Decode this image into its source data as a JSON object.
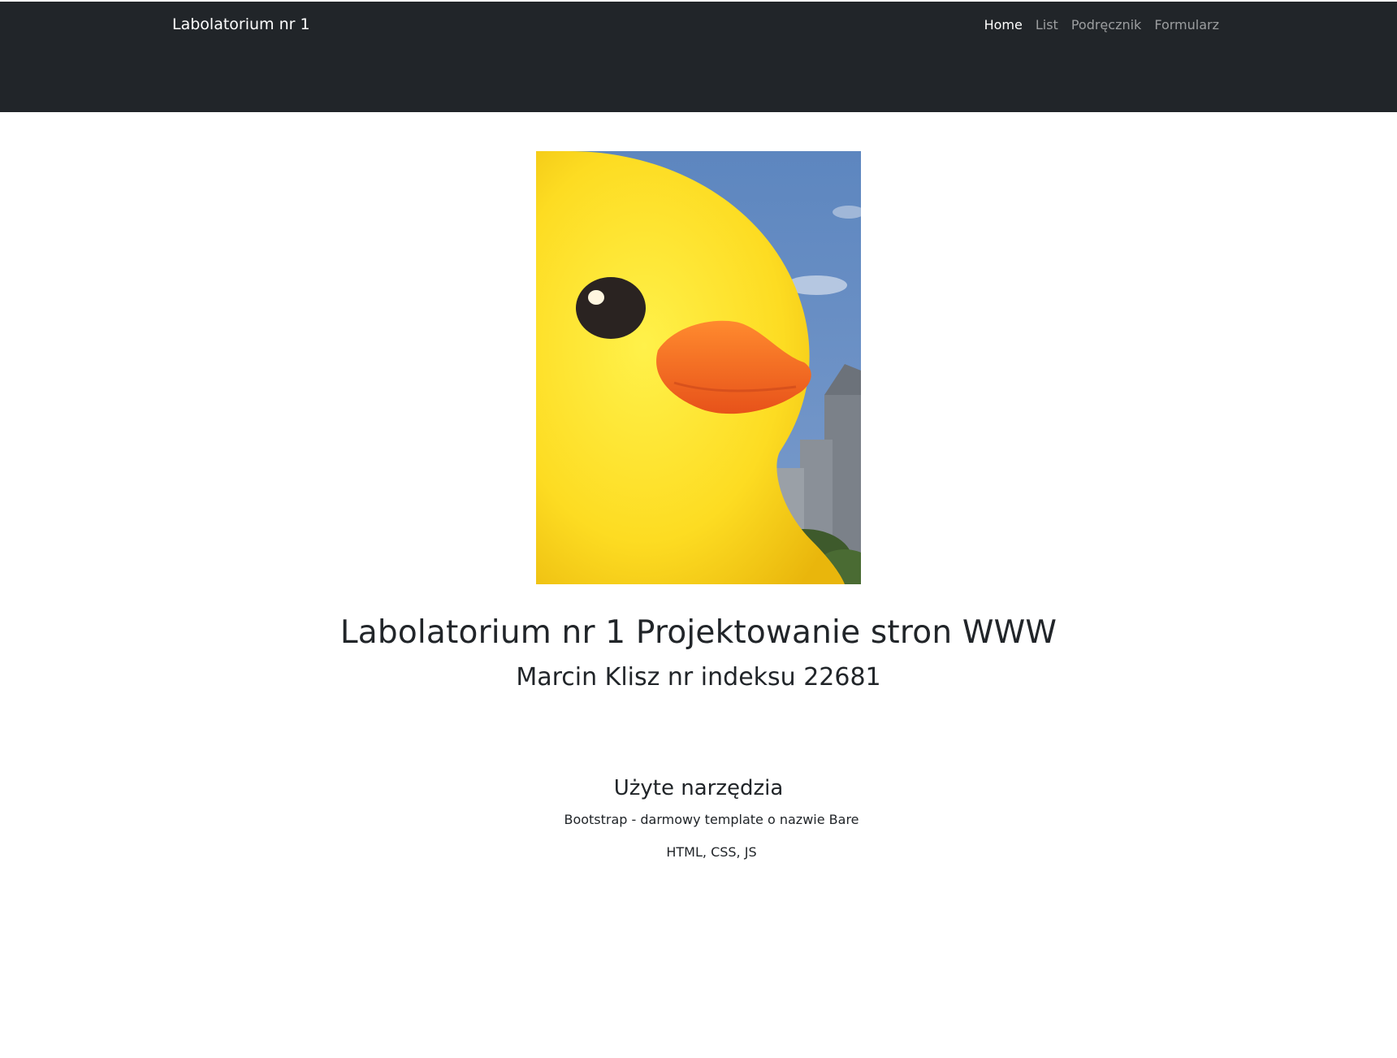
{
  "navbar": {
    "brand": "Labolatorium nr 1",
    "links": [
      {
        "label": "Home",
        "active": true
      },
      {
        "label": "List",
        "active": false
      },
      {
        "label": "Podręcznik",
        "active": false
      },
      {
        "label": "Formularz",
        "active": false
      }
    ],
    "background": "#212529"
  },
  "hero": {
    "image_alt": "yellow rubber duck",
    "title": "Labolatorium nr 1 Projektowanie stron WWW",
    "subtitle": "Marcin Klisz nr indeksu 22681"
  },
  "tools": {
    "heading": "Użyte narzędzia",
    "items": [
      "Bootstrap - darmowy template o nazwie Bare",
      "HTML, CSS, JS"
    ]
  }
}
